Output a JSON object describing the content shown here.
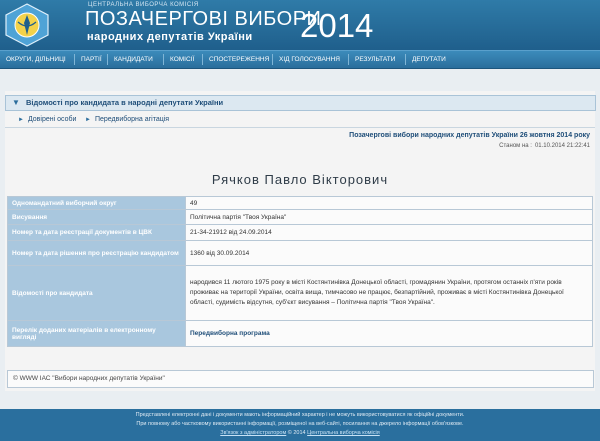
{
  "header": {
    "commission_label": "ЦЕНТРАЛЬНА ВИБОРЧА КОМІСІЯ",
    "title_line1": "ПОЗАЧЕРГОВІ ВИБОРИ",
    "title_line2": "народних депутатів України",
    "year": "2014",
    "brand_color": "#1f5f8c"
  },
  "nav": {
    "items": [
      "ОКРУГИ, ДІЛЬНИЦІ",
      "ПАРТІЇ",
      "КАНДИДАТИ",
      "КОМІСІЇ",
      "СПОСТЕРЕЖЕННЯ",
      "ХІД ГОЛОСУВАННЯ",
      "РЕЗУЛЬТАТИ",
      "ДЕПУТАТИ"
    ]
  },
  "section": {
    "title": "Відомості про кандидата в народні депутати України",
    "links": [
      "Довірені особи",
      "Передвиборна агітація"
    ]
  },
  "election_title": "Позачергові вибори народних депутатів України 26 жовтня 2014 року",
  "status": {
    "label": "Станом на :",
    "datetime": "01.10.2014 21:22:41"
  },
  "candidate": {
    "name": "Рячков Павло Вікторович",
    "rows": [
      {
        "label": "Одномандатний виборчий округ",
        "value": "49"
      },
      {
        "label": "Висування",
        "value": "Політична партія \"Твоя Україна\""
      },
      {
        "label": "Номер та дата реєстрації документів в ЦВК",
        "value": "21-34-21912 від 24.09.2014"
      },
      {
        "label": "Номер та дата рішення про реєстрацію кандидатом",
        "value": "1360 від 30.09.2014"
      },
      {
        "label": "Відомості про кандидата",
        "value": "народився 11 лютого 1975 року в місті Костянтинівка Донецької області, громадянин України, протягом останніх п'яти років проживає на території України, освіта вища, тимчасово не працює, безпартійний, проживає в місті Костянтинівка Донецької області, судимість відсутня, суб'єкт висування – Політична партія \"Твоя Україна\"."
      },
      {
        "label": "Перелік доданих матеріалів в електронному вигляді",
        "value": "Передвиборна програма"
      }
    ]
  },
  "copyright": "© WWW ІАС \"Вибори народних депутатів України\"",
  "footer": {
    "line1": "Представлені електронні дані і документи мають інформаційний характер і не можуть використовуватися як офіційні документи.",
    "line2": "При повному або частковому використанні інформації, розміщеної на веб-сайті, посилання на джерело інформації обов'язкове.",
    "link1": "Зв'язок з адміністратором",
    "middle": "© 2014",
    "link2": "Центральна виборча комісія"
  }
}
